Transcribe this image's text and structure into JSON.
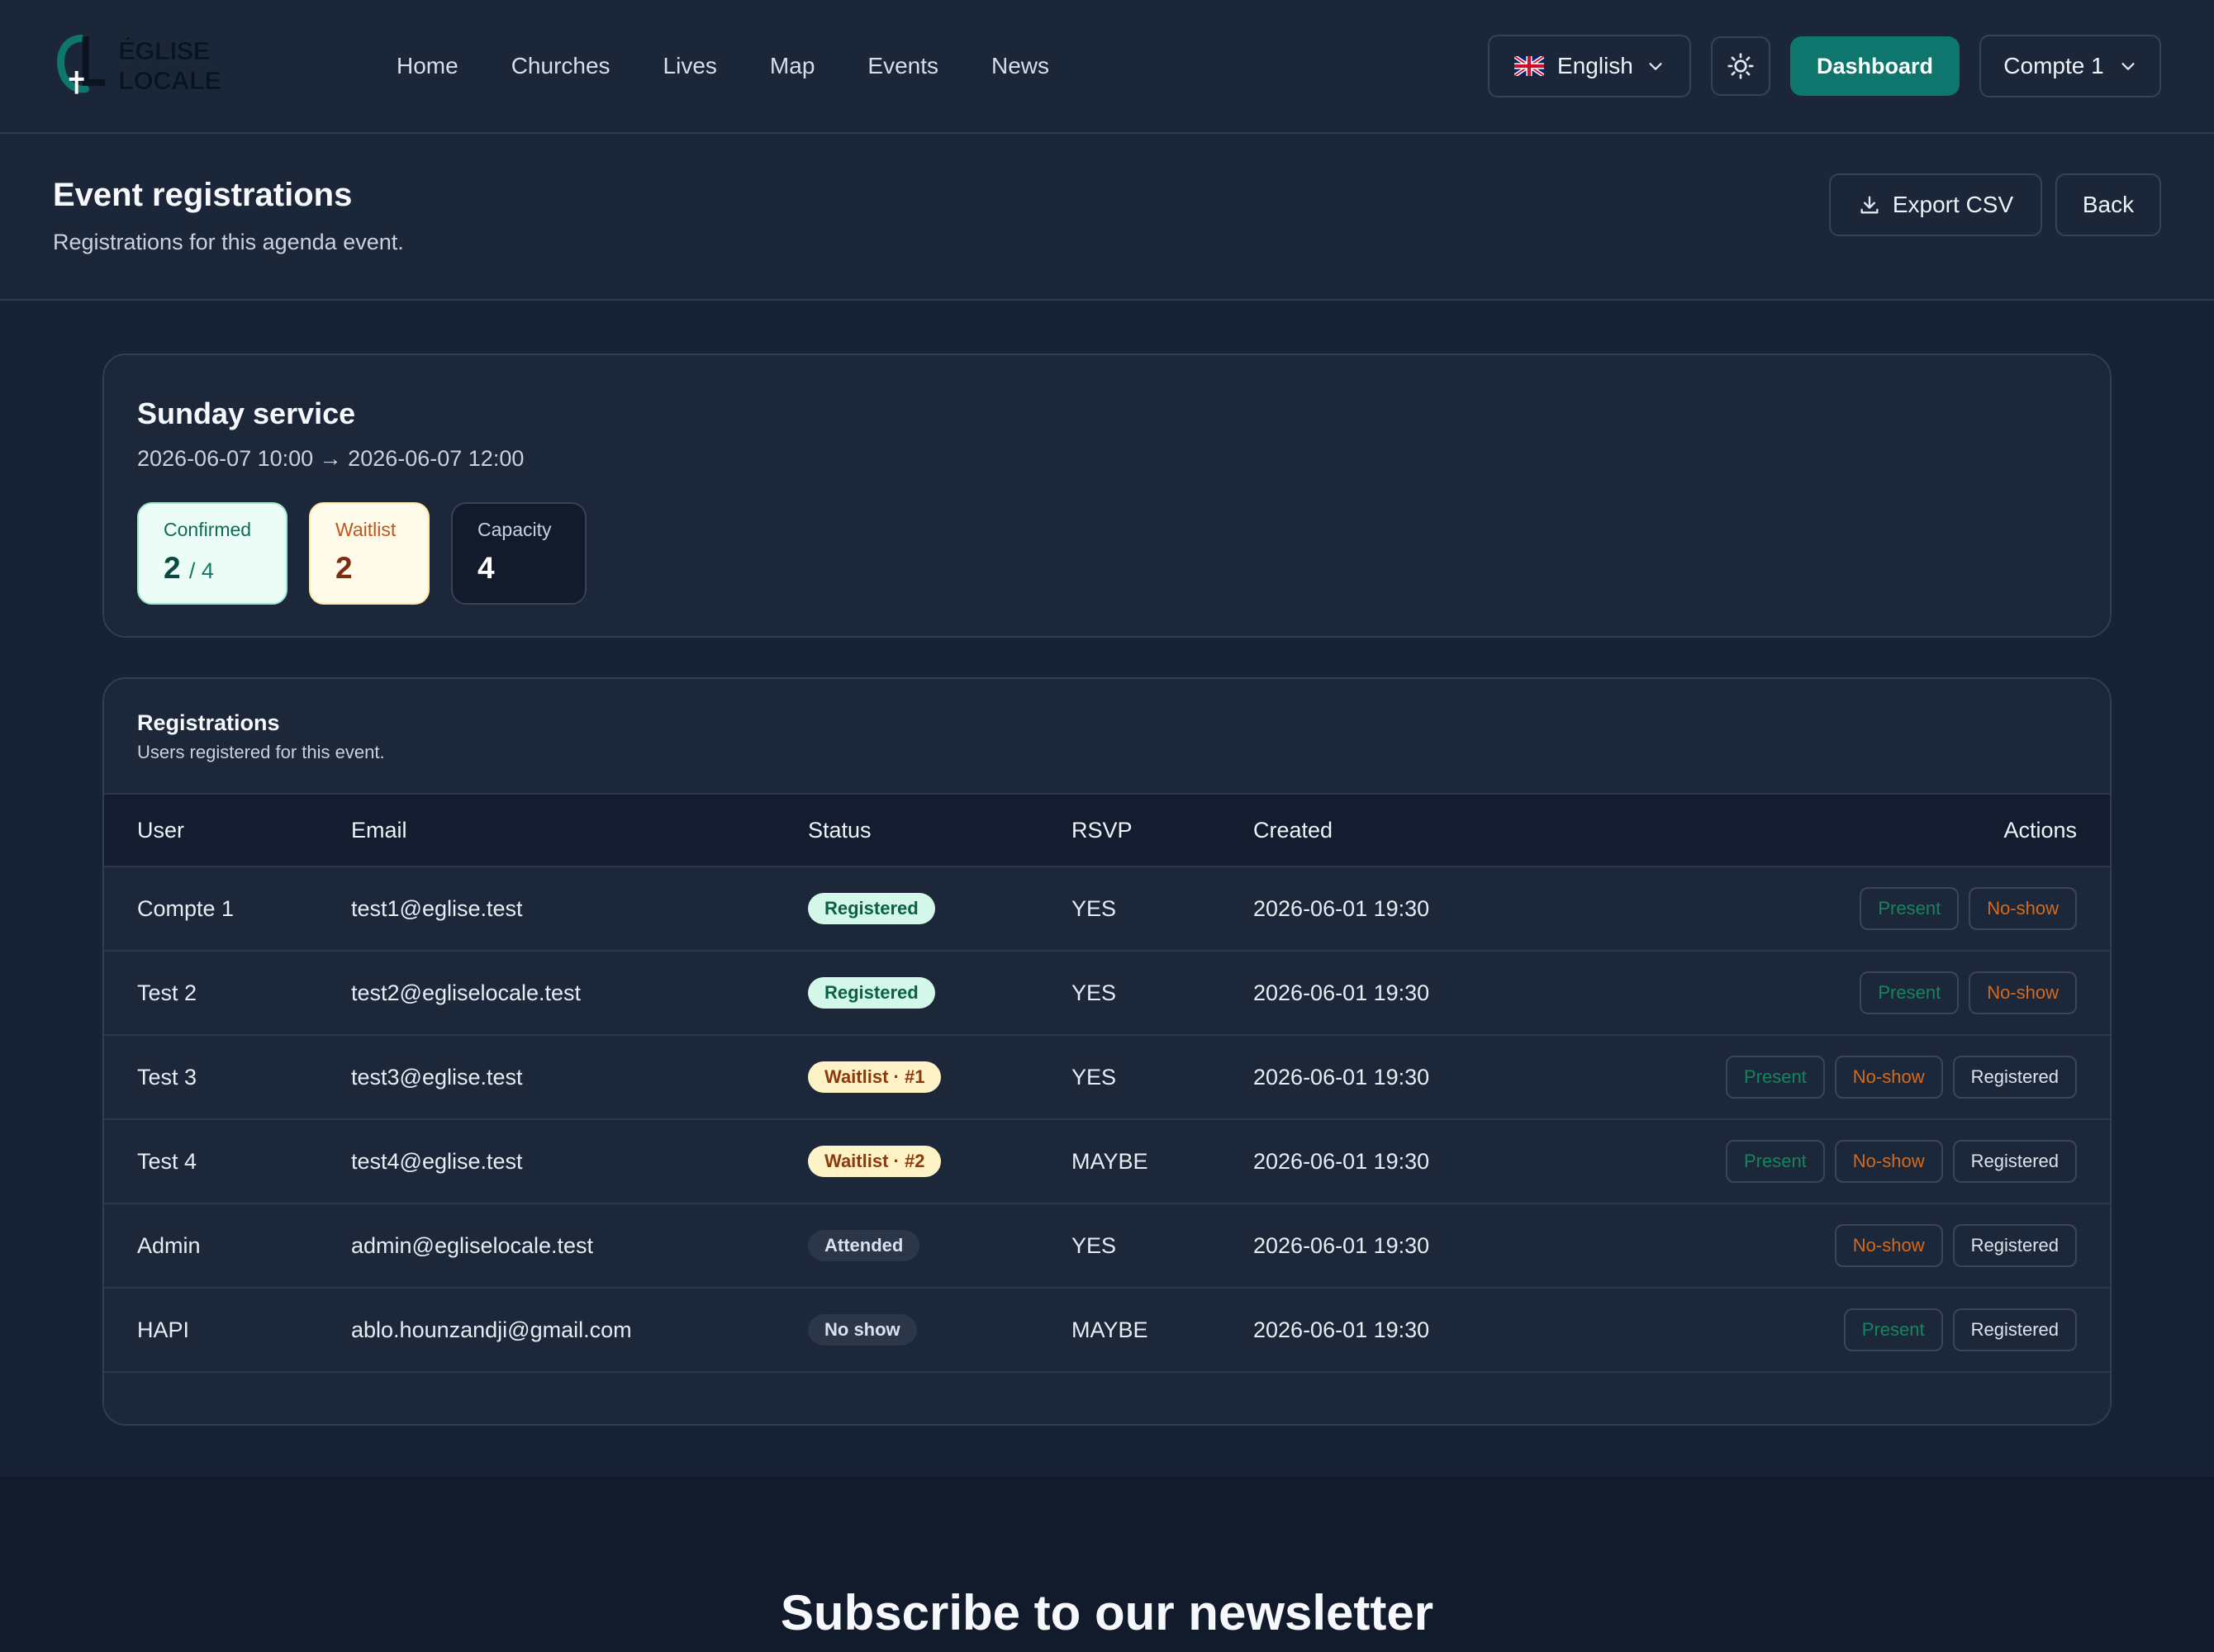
{
  "nav": {
    "logo_text": "ÉGLISE LOCALE",
    "links": [
      "Home",
      "Churches",
      "Lives",
      "Map",
      "Events",
      "News"
    ],
    "language": "English",
    "dashboard_label": "Dashboard",
    "account_label": "Compte 1"
  },
  "header": {
    "title": "Event registrations",
    "subtitle": "Registrations for this agenda event.",
    "export_label": "Export CSV",
    "back_label": "Back"
  },
  "event": {
    "title": "Sunday service",
    "dates": "2026-06-07 10:00 → 2026-06-07 12:00",
    "stats": {
      "confirmed_label": "Confirmed",
      "confirmed_value": "2",
      "confirmed_total": "/ 4",
      "waitlist_label": "Waitlist",
      "waitlist_value": "2",
      "capacity_label": "Capacity",
      "capacity_value": "4"
    }
  },
  "registrations": {
    "title": "Registrations",
    "subtitle": "Users registered for this event.",
    "columns": [
      "User",
      "Email",
      "Status",
      "RSVP",
      "Created",
      "Actions"
    ],
    "rows": [
      {
        "user": "Compte 1",
        "email": "test1@eglise.test",
        "status": "Registered",
        "rsvp": "YES",
        "created": "2026-06-01 19:30",
        "actions": [
          "Present",
          "No-show"
        ]
      },
      {
        "user": "Test 2",
        "email": "test2@egliselocale.test",
        "status": "Registered",
        "rsvp": "YES",
        "created": "2026-06-01 19:30",
        "actions": [
          "Present",
          "No-show"
        ]
      },
      {
        "user": "Test 3",
        "email": "test3@eglise.test",
        "status": "Waitlist · #1",
        "rsvp": "YES",
        "created": "2026-06-01 19:30",
        "actions": [
          "Present",
          "No-show",
          "Registered"
        ]
      },
      {
        "user": "Test 4",
        "email": "test4@eglise.test",
        "status": "Waitlist · #2",
        "rsvp": "MAYBE",
        "created": "2026-06-01 19:30",
        "actions": [
          "Present",
          "No-show",
          "Registered"
        ]
      },
      {
        "user": "Admin",
        "email": "admin@egliselocale.test",
        "status": "Attended",
        "rsvp": "YES",
        "created": "2026-06-01 19:30",
        "actions": [
          "No-show",
          "Registered"
        ]
      },
      {
        "user": "HAPI",
        "email": "ablo.hounzandji@gmail.com",
        "status": "No show",
        "rsvp": "MAYBE",
        "created": "2026-06-01 19:30",
        "actions": [
          "Present",
          "Registered"
        ]
      }
    ]
  },
  "footer": {
    "newsletter_title": "Subscribe to our newsletter"
  },
  "colors": {
    "accent": "#0f766e",
    "background": "#172236",
    "surface": "#1d273a"
  }
}
